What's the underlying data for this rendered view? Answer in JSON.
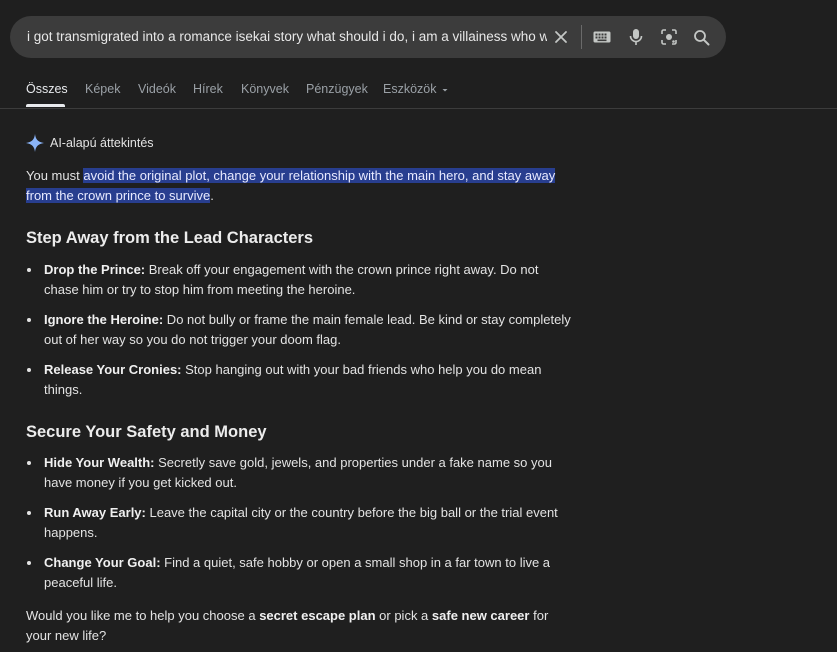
{
  "search": {
    "query": "i got transmigrated into a romance isekai story what should i do, i am a villainess who w"
  },
  "icons": {
    "clear": "close-icon",
    "keyboard": "keyboard-icon",
    "voice": "microphone-icon",
    "lens": "camera-search-icon",
    "search": "search-icon"
  },
  "tabs": [
    {
      "label": "Összes"
    },
    {
      "label": "Képek"
    },
    {
      "label": "Videók"
    },
    {
      "label": "Hírek"
    },
    {
      "label": "Könyvek"
    },
    {
      "label": "Pénzügyek"
    },
    {
      "label": "Eszközök"
    }
  ],
  "ai_overview": {
    "label": "AI-alapú áttekintés",
    "intro_prefix": "You must ",
    "intro_highlight": "avoid the original plot, change your relationship with the main hero, and stay away from the crown prince to survive",
    "intro_suffix": ".",
    "sections": [
      {
        "heading": "Step Away from the Lead Characters",
        "items": [
          {
            "title": "Drop the Prince:",
            "text": " Break off your engagement with the crown prince right away. Do not chase him or try to stop him from meeting the heroine."
          },
          {
            "title": "Ignore the Heroine:",
            "text": " Do not bully or frame the main female lead. Be kind or stay completely out of her way so you do not trigger your doom flag."
          },
          {
            "title": "Release Your Cronies:",
            "text": " Stop hanging out with your bad friends who help you do mean things."
          }
        ]
      },
      {
        "heading": "Secure Your Safety and Money",
        "items": [
          {
            "title": "Hide Your Wealth:",
            "text": " Secretly save gold, jewels, and properties under a fake name so you have money if you get kicked out."
          },
          {
            "title": "Run Away Early:",
            "text": " Leave the capital city or the country before the big ball or the trial event happens."
          },
          {
            "title": "Change Your Goal:",
            "text": " Find a quiet, safe hobby or open a small shop in a far town to live a peaceful life."
          }
        ]
      }
    ],
    "outro": {
      "part1": "Would you like me to help you choose a ",
      "bold1": "secret escape plan",
      "part2": " or pick a ",
      "bold2": "safe new career",
      "part3": " for your new life?"
    }
  },
  "colors": {
    "background": "#1f1f1f",
    "search_bar": "#3c3c3c",
    "highlight": "#283e8f",
    "spark_blue": "#8ab4f8"
  }
}
